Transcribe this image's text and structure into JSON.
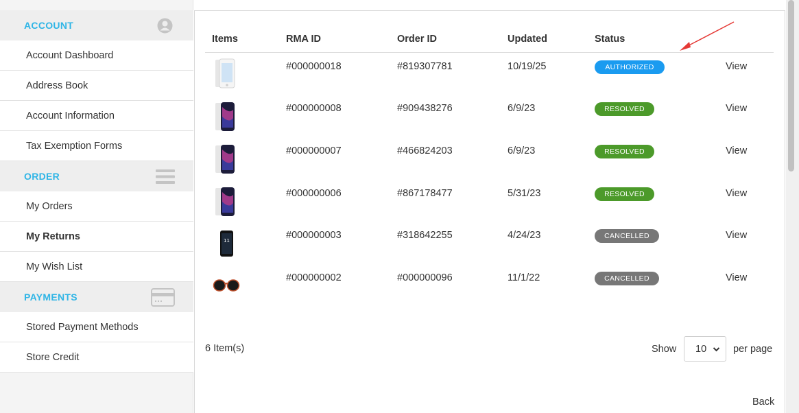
{
  "sidebar": {
    "account": {
      "title": "ACCOUNT",
      "icon": "user-icon",
      "items": [
        "Account Dashboard",
        "Address Book",
        "Account Information",
        "Tax Exemption Forms"
      ]
    },
    "order": {
      "title": "ORDER",
      "icon": "list-icon",
      "items": [
        "My Orders",
        "My Returns",
        "My Wish List"
      ],
      "active": "My Returns"
    },
    "payments": {
      "title": "PAYMENTS",
      "icon": "credit-card-icon",
      "items": [
        "Stored Payment Methods",
        "Store Credit"
      ]
    }
  },
  "table": {
    "headers": {
      "items": "Items",
      "rma_id": "RMA ID",
      "order_id": "Order ID",
      "updated": "Updated",
      "status": "Status"
    },
    "view_label": "View",
    "rows": [
      {
        "thumb": "phone-white-icon",
        "rma": "#000000018",
        "order": "#819307781",
        "updated": "10/19/25",
        "status": "AUTHORIZED",
        "status_color": "#1a9bf0"
      },
      {
        "thumb": "phone-purple-icon",
        "rma": "#000000008",
        "order": "#909438276",
        "updated": "6/9/23",
        "status": "RESOLVED",
        "status_color": "#4c9a2a"
      },
      {
        "thumb": "phone-purple-icon",
        "rma": "#000000007",
        "order": "#466824203",
        "updated": "6/9/23",
        "status": "RESOLVED",
        "status_color": "#4c9a2a"
      },
      {
        "thumb": "phone-purple-icon",
        "rma": "#000000006",
        "order": "#867178477",
        "updated": "5/31/23",
        "status": "RESOLVED",
        "status_color": "#4c9a2a"
      },
      {
        "thumb": "phone-black-icon",
        "rma": "#000000003",
        "order": "#318642255",
        "updated": "4/24/23",
        "status": "CANCELLED",
        "status_color": "#777777"
      },
      {
        "thumb": "sunglasses-icon",
        "rma": "#000000002",
        "order": "#000000096",
        "updated": "11/1/22",
        "status": "CANCELLED",
        "status_color": "#777777"
      }
    ]
  },
  "footer": {
    "count": "6 Item(s)",
    "show": "Show",
    "per_page_value": "10",
    "per_page": "per page",
    "back": "Back"
  },
  "colors": {
    "accent": "#2fb5e6",
    "annotation_arrow": "#e53935"
  }
}
